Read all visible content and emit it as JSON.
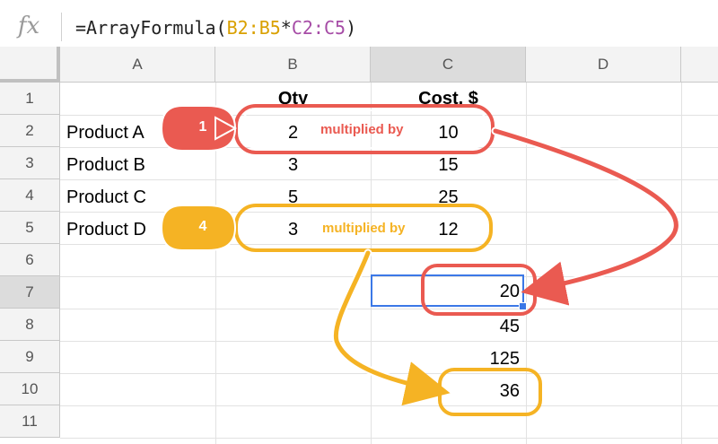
{
  "formula_bar": {
    "fx_label": "fx",
    "formula_prefix": "=ArrayFormula(",
    "ref1": "B2:B5",
    "operator": "*",
    "ref2": "C2:C5",
    "formula_suffix": ")"
  },
  "columns": [
    "A",
    "B",
    "C",
    "D"
  ],
  "rows": [
    "1",
    "2",
    "3",
    "4",
    "5",
    "6",
    "7",
    "8",
    "9",
    "10",
    "11"
  ],
  "header_row": {
    "qty": "Qty",
    "cost": "Cost, $"
  },
  "products": [
    {
      "name": "Product A",
      "qty": "2",
      "cost": "10"
    },
    {
      "name": "Product B",
      "qty": "3",
      "cost": "15"
    },
    {
      "name": "Product C",
      "qty": "5",
      "cost": "25"
    },
    {
      "name": "Product D",
      "qty": "3",
      "cost": "12"
    }
  ],
  "results": [
    "20",
    "45",
    "125",
    "36"
  ],
  "annotations": {
    "first": {
      "badge": "1",
      "label": "multiplied by"
    },
    "fourth": {
      "badge": "4",
      "label": "multiplied by"
    }
  },
  "colors": {
    "red": "#ea5a51",
    "orange": "#f5b324",
    "ref1": "#d9a000",
    "ref2": "#a64ca6",
    "selection": "#3b78e7"
  }
}
